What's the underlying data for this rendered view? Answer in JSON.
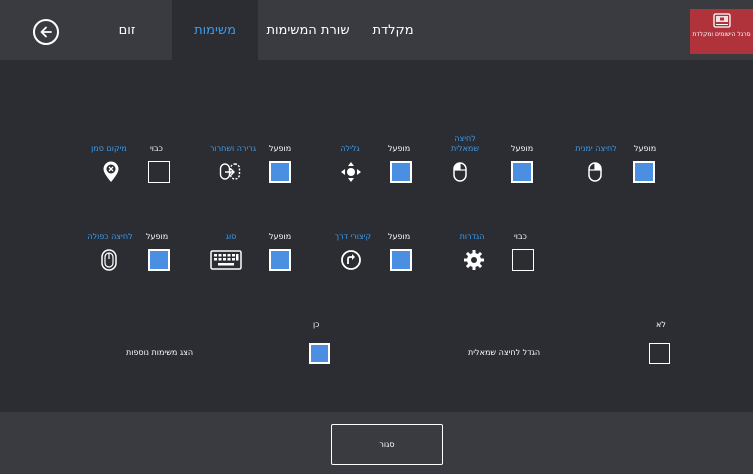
{
  "header": {
    "tabs": [
      {
        "label": "מקלדת",
        "active": false
      },
      {
        "label": "שורת המשימות",
        "active": false
      },
      {
        "label": "משימות",
        "active": true
      },
      {
        "label": "זום",
        "active": false
      }
    ],
    "corner_label": "סרגל הישומים ומקלדת"
  },
  "tiles": {
    "right_click": {
      "state": "מופעל",
      "name": "לחיצה ימנית",
      "checked": true,
      "icon": "mouse-right-icon"
    },
    "left_click": {
      "state": "מופעל",
      "name": "לחיצה שמאלית",
      "checked": true,
      "icon": "mouse-left-icon"
    },
    "scroll": {
      "state": "מופעל",
      "name": "גלילה",
      "checked": true,
      "icon": "scroll-arrows-icon"
    },
    "drag_drop": {
      "state": "מופעל",
      "name": "גרירה ושחרור",
      "checked": true,
      "icon": "drag-drop-icon"
    },
    "marker": {
      "state": "כבוי",
      "name": "מיקום סמן",
      "checked": false,
      "icon": "location-pin-icon"
    },
    "settings": {
      "state": "כבוי",
      "name": "הגדרות",
      "checked": false,
      "icon": "gear-icon"
    },
    "shortcuts": {
      "state": "מופעל",
      "name": "קיצורי דרך",
      "checked": true,
      "icon": "shortcut-arrow-icon"
    },
    "type": {
      "state": "מופעל",
      "name": "סוג",
      "checked": true,
      "icon": "keyboard-icon"
    },
    "double_click": {
      "state": "מופעל",
      "name": "לחיצה כפולה",
      "checked": true,
      "icon": "mouse-double-icon"
    }
  },
  "options": {
    "enlarge_left": {
      "state": "לא",
      "label": "הגדל לחיצה שמאלית",
      "checked": false
    },
    "more_tasks": {
      "state": "כן",
      "label": "הצג משימות נוספות",
      "checked": true
    }
  },
  "footer": {
    "close_label": "סגור"
  },
  "colors": {
    "accent": "#3d9be9",
    "checkbox_on": "#4a8fe1",
    "corner": "#b0323b",
    "bg": "#2c2d33",
    "bar": "#3a3b41"
  }
}
